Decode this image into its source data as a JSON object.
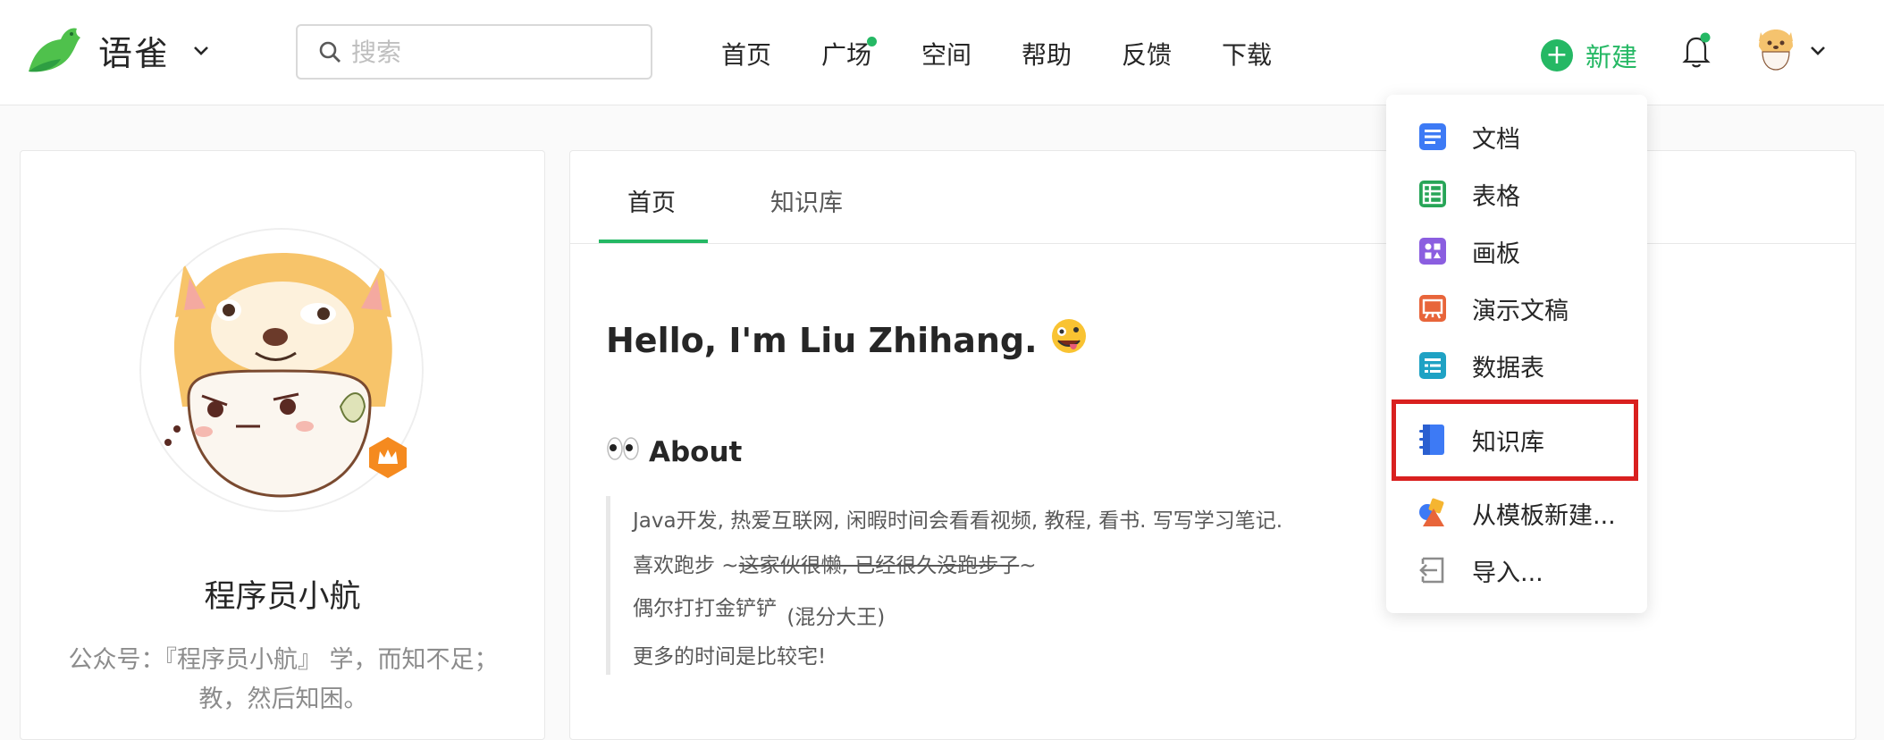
{
  "brand": {
    "name": "语雀",
    "logo_icon": "yuque-bird-icon",
    "accent": "#25b864"
  },
  "search": {
    "placeholder": "搜索"
  },
  "nav": [
    {
      "label": "首页",
      "has_dot": false
    },
    {
      "label": "广场",
      "has_dot": true
    },
    {
      "label": "空间",
      "has_dot": false
    },
    {
      "label": "帮助",
      "has_dot": false
    },
    {
      "label": "反馈",
      "has_dot": false
    },
    {
      "label": "下载",
      "has_dot": false
    }
  ],
  "new_button": {
    "label": "新建",
    "icon": "plus-circle-icon"
  },
  "notifications": {
    "icon": "bell-icon",
    "has_unread": true
  },
  "profile": {
    "name": "程序员小航",
    "bio": "公众号：『程序员小航』 学，而知不足；教，然后知困。",
    "badge_icon": "crown-icon"
  },
  "tabs": [
    {
      "label": "首页",
      "active": true
    },
    {
      "label": "知识库",
      "active": false
    }
  ],
  "content": {
    "hello": "Hello, I'm Liu Zhihang.",
    "hello_emoji": "🤪",
    "about_emoji": "👀",
    "about_title": "About",
    "lines": {
      "line1": "Java开发, 热爱互联网, 闲暇时间会看看视频, 教程, 看书. 写写学习笔记.",
      "line2_prefix": "喜欢跑步 ~",
      "line2_strike": "这家伙很懒, 已经很久没跑步了",
      "line2_suffix": "~",
      "line3_main": "偶尔打打金铲铲",
      "line3_small": "(混分大王)",
      "line4": "更多的时间是比较宅!"
    }
  },
  "new_menu": {
    "items": [
      {
        "label": "文档",
        "icon": "doc-icon",
        "color": "#3d7af5"
      },
      {
        "label": "表格",
        "icon": "sheet-icon",
        "color": "#27a557"
      },
      {
        "label": "画板",
        "icon": "board-icon",
        "color": "#8b5ee0"
      },
      {
        "label": "演示文稿",
        "icon": "slides-icon",
        "color": "#e8653a"
      },
      {
        "label": "数据表",
        "icon": "datatable-icon",
        "color": "#1fa2c4"
      },
      {
        "label": "知识库",
        "icon": "knowledge-base-icon",
        "color": "#3d7af5",
        "highlighted": true
      },
      {
        "label": "从模板新建...",
        "icon": "template-icon",
        "color": "#e8653a"
      },
      {
        "label": "导入...",
        "icon": "import-icon",
        "color": "#8c8c8c"
      }
    ]
  },
  "highlight_color": "#d9201f"
}
